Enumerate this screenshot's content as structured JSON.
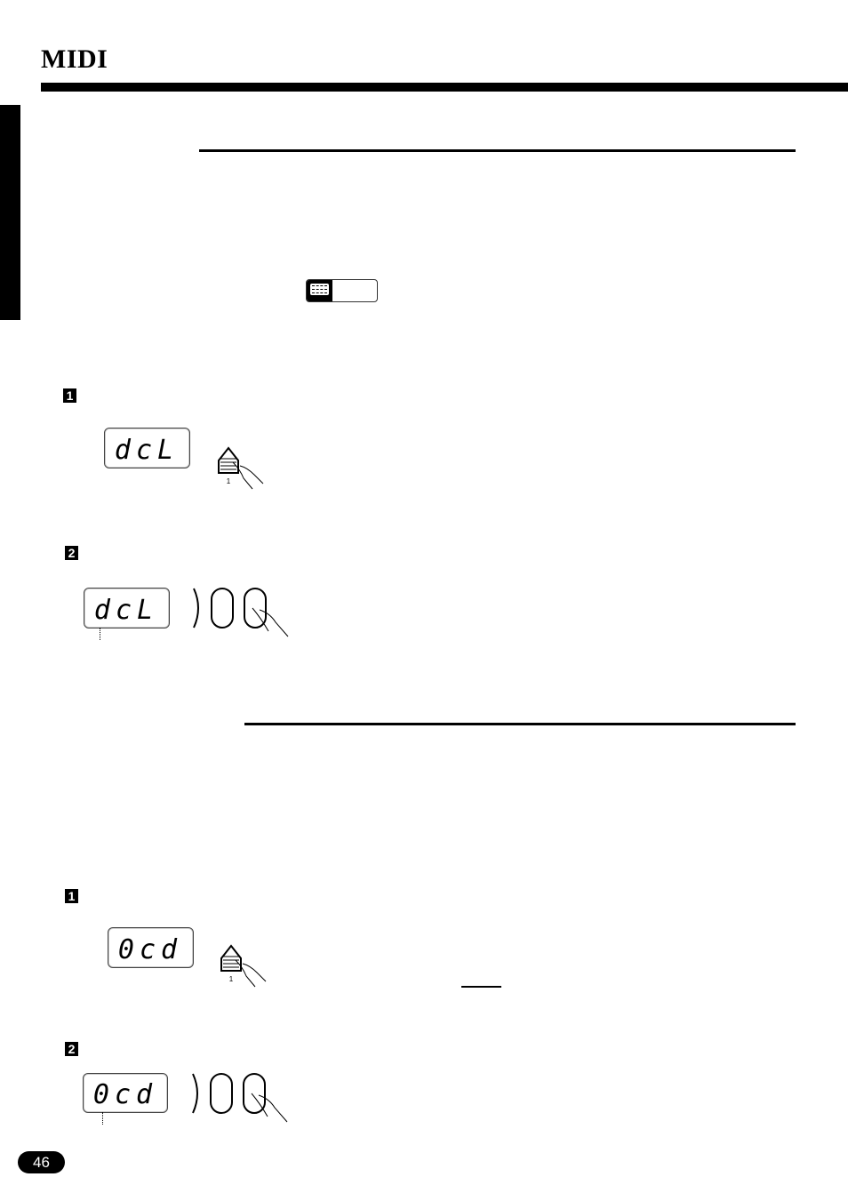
{
  "header": {
    "title": "MIDI"
  },
  "note_icon": "speech-bubble-note-icon",
  "sections": [
    {
      "steps": [
        {
          "number": "1",
          "display": "dcL",
          "button": "up-arrow-button",
          "button_label": "1"
        },
        {
          "number": "2",
          "display": "dcL",
          "button": "oval-buttons"
        }
      ]
    },
    {
      "steps": [
        {
          "number": "1",
          "display": "0cd",
          "button": "up-arrow-button",
          "button_label": "1"
        },
        {
          "number": "2",
          "display": "0cd",
          "button": "oval-buttons"
        }
      ]
    }
  ],
  "footer": {
    "page_number": "46"
  }
}
